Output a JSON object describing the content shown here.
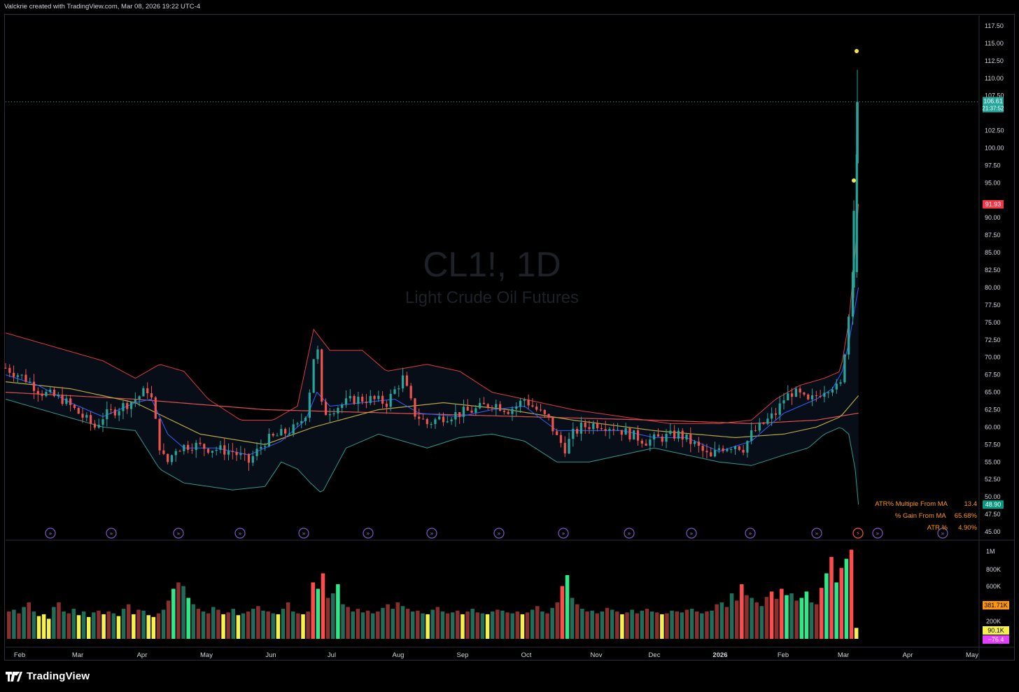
{
  "caption": "Valckrie created with TradingView.com, Mar 08, 2026 19:22 UTC-4",
  "brand": "TradingView",
  "colors": {
    "up": "#26a69a",
    "down": "#ef5350",
    "bb_upper": "#e03a3e",
    "bb_lower": "#2f9c89",
    "ema_fast": "#2962ff",
    "sma_mid": "#b5a642",
    "sma_slow": "#e05050",
    "vol_up": "#2ee88a",
    "vol_down": "#ff4b4b",
    "vol_low": "#f5f04a",
    "label_orange": "#ff9800"
  },
  "stats": [
    {
      "label": "ATR% Multiple From MA",
      "value": "13.4"
    },
    {
      "label": "% Gain From MA",
      "value": "65.68%"
    },
    {
      "label": "ATR %",
      "value": "4.90%"
    }
  ],
  "chart_data": {
    "type": "candlestick",
    "symbol": "CL1!, 1D",
    "name": "Light Crude Oil Futures",
    "x_ticks": [
      "Feb",
      "Mar",
      "Apr",
      "May",
      "Jun",
      "Jul",
      "Aug",
      "Sep",
      "Oct",
      "Nov",
      "Dec",
      "2026",
      "Feb",
      "Mar",
      "Apr",
      "May"
    ],
    "price_ticks": [
      "117.50",
      "115.00",
      "112.50",
      "110.00",
      "107.50",
      "102.50",
      "100.00",
      "97.50",
      "95.00",
      "90.00",
      "87.50",
      "85.00",
      "82.50",
      "80.00",
      "77.50",
      "75.00",
      "72.50",
      "70.00",
      "67.50",
      "65.00",
      "62.50",
      "60.00",
      "57.50",
      "55.00",
      "52.50",
      "50.00",
      "47.50",
      "45.00"
    ],
    "ylim": [
      44,
      119
    ],
    "last_price": {
      "value": "106.61",
      "countdown": "21:37:52"
    },
    "upper_band_label": "91.93",
    "lower_band_label": "48.90",
    "volume_ticks": [
      "1M",
      "800K",
      "600K",
      "200K"
    ],
    "volume_labels": [
      {
        "text": "381.71K",
        "color": "#ff9800"
      },
      {
        "text": "90.1K",
        "color": "#f5f04a"
      },
      {
        "text": "−76.4",
        "color": "#e040fb"
      }
    ],
    "price_path": [
      [
        0,
        68.5
      ],
      [
        12,
        67
      ],
      [
        22,
        65
      ],
      [
        35,
        64
      ],
      [
        45,
        62
      ],
      [
        55,
        60
      ],
      [
        60,
        61.5
      ],
      [
        72,
        63
      ],
      [
        80,
        64
      ],
      [
        88,
        65.5
      ],
      [
        90,
        64
      ],
      [
        93,
        60
      ],
      [
        96,
        56
      ],
      [
        100,
        55
      ],
      [
        105,
        57
      ],
      [
        115,
        57.5
      ],
      [
        125,
        57
      ],
      [
        140,
        56.5
      ],
      [
        150,
        55
      ],
      [
        160,
        58
      ],
      [
        170,
        59
      ],
      [
        180,
        60
      ],
      [
        185,
        62
      ],
      [
        188,
        66
      ],
      [
        190,
        70
      ],
      [
        192,
        73
      ],
      [
        194,
        64
      ],
      [
        196,
        62
      ],
      [
        205,
        63
      ],
      [
        215,
        64
      ],
      [
        225,
        64
      ],
      [
        235,
        63.5
      ],
      [
        245,
        67
      ],
      [
        248,
        65
      ],
      [
        252,
        62
      ],
      [
        260,
        60.5
      ],
      [
        270,
        61.5
      ],
      [
        280,
        62
      ],
      [
        290,
        62.5
      ],
      [
        300,
        63.5
      ],
      [
        310,
        62.5
      ],
      [
        315,
        63
      ],
      [
        320,
        64
      ],
      [
        330,
        62
      ],
      [
        335,
        61
      ],
      [
        340,
        58.5
      ],
      [
        345,
        57
      ],
      [
        350,
        59
      ],
      [
        355,
        60
      ],
      [
        365,
        60.5
      ],
      [
        375,
        60
      ],
      [
        385,
        59
      ],
      [
        395,
        58
      ],
      [
        405,
        58.5
      ],
      [
        415,
        59
      ],
      [
        425,
        57.5
      ],
      [
        430,
        56.5
      ],
      [
        435,
        55.5
      ],
      [
        440,
        57
      ],
      [
        450,
        57.5
      ],
      [
        455,
        57
      ],
      [
        460,
        59
      ],
      [
        465,
        60
      ],
      [
        470,
        61
      ],
      [
        475,
        62
      ],
      [
        480,
        64
      ],
      [
        485,
        65
      ],
      [
        490,
        64.5
      ],
      [
        495,
        63.5
      ],
      [
        500,
        64.5
      ],
      [
        505,
        65.5
      ],
      [
        510,
        66
      ],
      [
        512,
        65.5
      ],
      [
        515,
        66
      ],
      [
        518,
        72
      ],
      [
        520,
        76
      ],
      [
        522,
        80
      ],
      [
        524,
        92
      ],
      [
        526,
        106.61
      ]
    ],
    "ma_fast": [
      [
        0,
        67.5
      ],
      [
        20,
        66
      ],
      [
        40,
        63.5
      ],
      [
        60,
        61.5
      ],
      [
        80,
        63.5
      ],
      [
        90,
        64
      ],
      [
        100,
        59
      ],
      [
        110,
        57
      ],
      [
        130,
        57
      ],
      [
        150,
        56
      ],
      [
        170,
        58
      ],
      [
        185,
        61
      ],
      [
        192,
        65
      ],
      [
        200,
        63
      ],
      [
        220,
        63.5
      ],
      [
        240,
        64
      ],
      [
        255,
        62
      ],
      [
        280,
        61.5
      ],
      [
        300,
        62.5
      ],
      [
        320,
        63
      ],
      [
        340,
        59.5
      ],
      [
        360,
        59.5
      ],
      [
        380,
        59.5
      ],
      [
        400,
        58.5
      ],
      [
        420,
        58.5
      ],
      [
        440,
        56.5
      ],
      [
        460,
        58
      ],
      [
        480,
        62
      ],
      [
        500,
        64
      ],
      [
        510,
        65.5
      ],
      [
        516,
        68
      ],
      [
        520,
        72
      ],
      [
        526,
        80
      ]
    ],
    "sma_mid": [
      [
        0,
        66.5
      ],
      [
        40,
        65.5
      ],
      [
        80,
        63.5
      ],
      [
        120,
        59
      ],
      [
        160,
        57.5
      ],
      [
        190,
        60
      ],
      [
        230,
        62.5
      ],
      [
        270,
        63.5
      ],
      [
        310,
        62.5
      ],
      [
        350,
        61
      ],
      [
        400,
        59.5
      ],
      [
        450,
        58.5
      ],
      [
        480,
        59
      ],
      [
        500,
        60
      ],
      [
        515,
        61.5
      ],
      [
        526,
        64.5
      ]
    ],
    "sma_slow": [
      [
        0,
        65
      ],
      [
        80,
        64
      ],
      [
        160,
        62.5
      ],
      [
        240,
        62
      ],
      [
        320,
        61.5
      ],
      [
        400,
        61
      ],
      [
        460,
        60.5
      ],
      [
        500,
        61
      ],
      [
        526,
        62
      ]
    ],
    "bb_upper": [
      [
        0,
        73.5
      ],
      [
        30,
        71.5
      ],
      [
        60,
        69.5
      ],
      [
        80,
        67
      ],
      [
        95,
        69
      ],
      [
        110,
        68
      ],
      [
        125,
        64
      ],
      [
        145,
        61
      ],
      [
        165,
        61
      ],
      [
        180,
        63
      ],
      [
        190,
        74
      ],
      [
        200,
        71
      ],
      [
        220,
        71
      ],
      [
        235,
        68
      ],
      [
        260,
        69
      ],
      [
        280,
        68
      ],
      [
        300,
        65
      ],
      [
        320,
        64
      ],
      [
        350,
        62.5
      ],
      [
        380,
        61.5
      ],
      [
        410,
        60.5
      ],
      [
        440,
        60.5
      ],
      [
        460,
        61
      ],
      [
        475,
        64
      ],
      [
        490,
        66
      ],
      [
        505,
        67
      ],
      [
        515,
        68
      ],
      [
        520,
        75
      ],
      [
        524,
        85
      ],
      [
        526,
        92
      ]
    ],
    "bb_lower": [
      [
        0,
        64
      ],
      [
        30,
        62
      ],
      [
        60,
        60
      ],
      [
        80,
        59.5
      ],
      [
        95,
        54
      ],
      [
        110,
        52
      ],
      [
        125,
        51.5
      ],
      [
        140,
        51
      ],
      [
        160,
        51.5
      ],
      [
        170,
        55
      ],
      [
        180,
        54
      ],
      [
        188,
        52
      ],
      [
        195,
        50.5
      ],
      [
        210,
        57
      ],
      [
        230,
        59
      ],
      [
        260,
        57
      ],
      [
        280,
        58.5
      ],
      [
        300,
        59
      ],
      [
        320,
        58
      ],
      [
        340,
        55
      ],
      [
        360,
        55
      ],
      [
        380,
        56
      ],
      [
        400,
        57
      ],
      [
        420,
        56
      ],
      [
        440,
        55
      ],
      [
        460,
        54.5
      ],
      [
        480,
        56
      ],
      [
        495,
        57
      ],
      [
        505,
        59
      ],
      [
        515,
        60
      ],
      [
        520,
        59
      ],
      [
        524,
        54
      ],
      [
        526,
        48.9
      ]
    ],
    "volume": [
      0.3,
      0.32,
      0.28,
      0.35,
      0.4,
      0.3,
      0.25,
      0.27,
      0.22,
      0.35,
      0.4,
      0.3,
      0.28,
      0.33,
      0.26,
      0.3,
      0.24,
      0.29,
      0.31,
      0.27,
      0.3,
      0.28,
      0.25,
      0.33,
      0.38,
      0.27,
      0.32,
      0.31,
      0.26,
      0.24,
      0.28,
      0.32,
      0.42,
      0.55,
      0.62,
      0.58,
      0.45,
      0.38,
      0.33,
      0.3,
      0.28,
      0.35,
      0.32,
      0.27,
      0.29,
      0.33,
      0.26,
      0.28,
      0.3,
      0.33,
      0.36,
      0.31,
      0.3,
      0.28,
      0.27,
      0.33,
      0.4,
      0.3,
      0.28,
      0.27,
      0.3,
      0.62,
      0.55,
      0.72,
      0.45,
      0.5,
      0.6,
      0.38,
      0.35,
      0.3,
      0.33,
      0.29,
      0.31,
      0.28,
      0.3,
      0.34,
      0.38,
      0.33,
      0.4,
      0.36,
      0.33,
      0.3,
      0.31,
      0.28,
      0.27,
      0.32,
      0.35,
      0.3,
      0.28,
      0.29,
      0.31,
      0.27,
      0.3,
      0.33,
      0.29,
      0.28,
      0.27,
      0.3,
      0.32,
      0.31,
      0.29,
      0.28,
      0.3,
      0.27,
      0.29,
      0.32,
      0.36,
      0.3,
      0.28,
      0.34,
      0.4,
      0.58,
      0.7,
      0.45,
      0.38,
      0.33,
      0.3,
      0.31,
      0.28,
      0.3,
      0.34,
      0.32,
      0.3,
      0.27,
      0.29,
      0.32,
      0.28,
      0.31,
      0.33,
      0.3,
      0.29,
      0.27,
      0.28,
      0.31,
      0.3,
      0.29,
      0.32,
      0.33,
      0.3,
      0.28,
      0.3,
      0.31,
      0.38,
      0.4,
      0.35,
      0.5,
      0.42,
      0.6,
      0.48,
      0.45,
      0.4,
      0.36,
      0.46,
      0.52,
      0.44,
      0.55,
      0.48,
      0.5,
      0.42,
      0.45,
      0.52,
      0.4,
      0.38,
      0.56,
      0.72,
      0.9,
      0.62,
      0.78,
      0.88,
      0.98,
      0.12
    ]
  }
}
